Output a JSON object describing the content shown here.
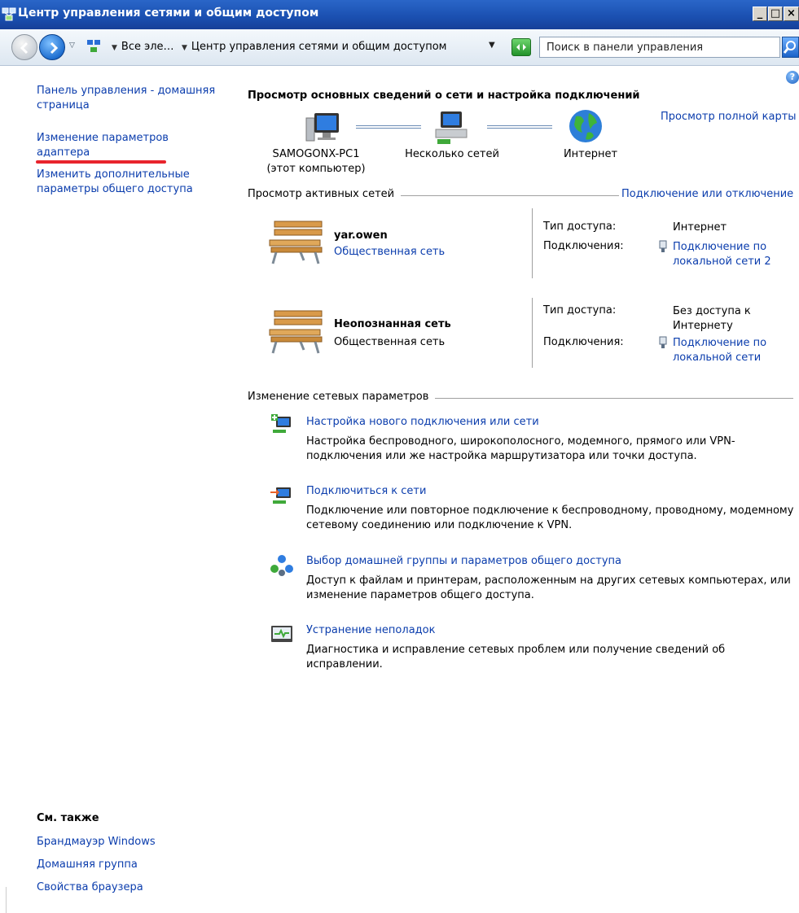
{
  "window": {
    "title": "Центр управления сетями и общим доступом",
    "minimize": "_",
    "maximize": "□",
    "close": "×"
  },
  "address": {
    "crumbs": [
      "Все эле…",
      "Центр управления сетями и общим доступом"
    ],
    "search_placeholder": "Поиск в панели управления"
  },
  "help": "?",
  "sidebar": {
    "links": [
      "Панель управления - домашняя страница",
      "Изменение параметров адаптера",
      "Изменить дополнительные параметры общего доступа"
    ],
    "see_also_title": "См. также",
    "see_also": [
      "Брандмауэр Windows",
      "Домашняя группа",
      "Свойства браузера"
    ]
  },
  "main": {
    "title": "Просмотр основных сведений о сети и настройка подключений",
    "full_map": "Просмотр полной карты",
    "map": {
      "computer": "SAMOGONX-PC1",
      "computer_sub": "(этот компьютер)",
      "networks": "Несколько сетей",
      "internet": "Интернет"
    },
    "active_header": "Просмотр активных сетей",
    "connect_link": "Подключение или отключение",
    "access_label": "Тип доступа:",
    "connections_label": "Подключения:",
    "networks": [
      {
        "name": "yar.owen",
        "type": "Общественная сеть",
        "access": "Интернет",
        "connection": "Подключение по локальной сети 2"
      },
      {
        "name": "Неопознанная сеть",
        "type": "Общественная сеть",
        "access": "Без доступа к Интернету",
        "connection": "Подключение по локальной сети"
      }
    ],
    "change_header": "Изменение сетевых параметров",
    "tasks": [
      {
        "title": "Настройка нового подключения или сети",
        "desc": "Настройка беспроводного, широкополосного, модемного, прямого или VPN-подключения или же настройка маршрутизатора или точки доступа."
      },
      {
        "title": "Подключиться к сети",
        "desc": "Подключение или повторное подключение к беспроводному, проводному, модемному сетевому соединению или подключение к VPN."
      },
      {
        "title": "Выбор домашней группы и параметров общего доступа",
        "desc": "Доступ к файлам и принтерам, расположенным на других сетевых компьютерах, или изменение параметров общего доступа."
      },
      {
        "title": "Устранение неполадок",
        "desc": "Диагностика и исправление сетевых проблем или получение сведений об исправлении."
      }
    ]
  }
}
